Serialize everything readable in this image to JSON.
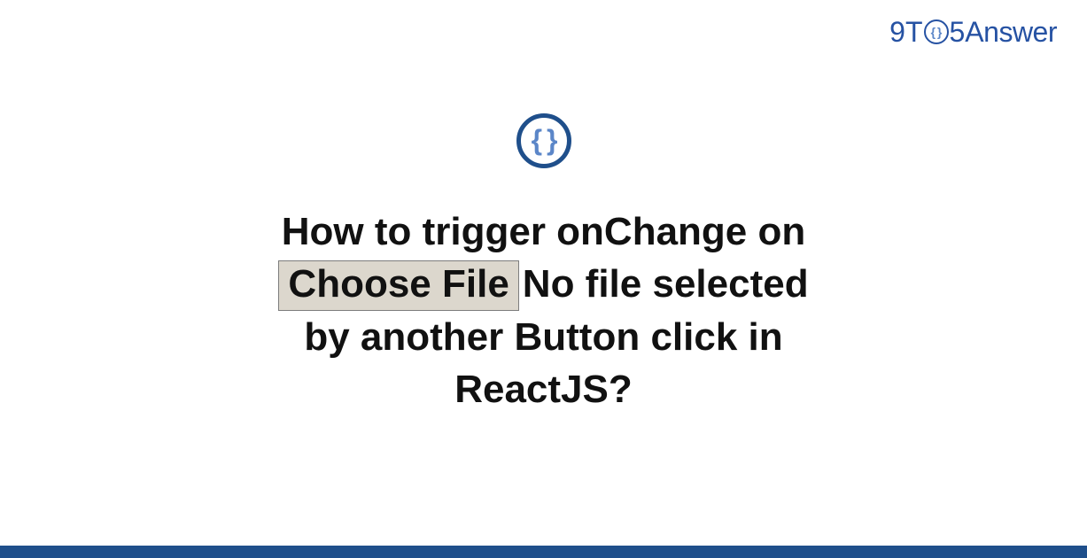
{
  "brand": {
    "nine": "9",
    "t": "T",
    "five": "5",
    "answer": "Answer",
    "mini_braces": "{ }"
  },
  "icon": {
    "braces": "{ }"
  },
  "question": {
    "line1": "How to trigger onChange on",
    "file_button": "Choose File",
    "file_status": "No file selected",
    "line3": "by another Button click in",
    "line4": "ReactJS?"
  }
}
